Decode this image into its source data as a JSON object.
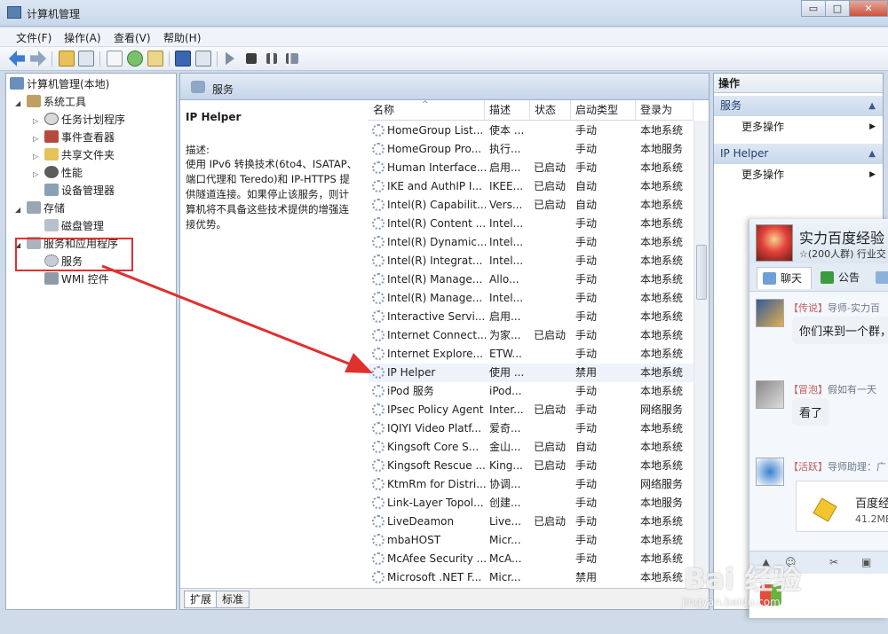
{
  "window": {
    "title": "计算机管理",
    "buttons": [
      "▭",
      "□",
      "✕"
    ]
  },
  "menu": [
    "文件(F)",
    "操作(A)",
    "查看(V)",
    "帮助(H)"
  ],
  "tree": {
    "root": "计算机管理(本地)",
    "system_tools": "系统工具",
    "task_scheduler": "任务计划程序",
    "event_viewer": "事件查看器",
    "shared_folders": "共享文件夹",
    "performance": "性能",
    "device_manager": "设备管理器",
    "storage": "存储",
    "disk_management": "磁盘管理",
    "services_apps": "服务和应用程序",
    "services": "服务",
    "wmi": "WMI 控件"
  },
  "main": {
    "header": "服务",
    "selected_service": "IP Helper",
    "desc_label": "描述:",
    "desc_lines": [
      "使用 IPv6 转换技术(6to4、ISATAP、",
      "端口代理和 Teredo)和 IP-HTTPS 提",
      "供隧道连接。如果停止该服务，则计",
      "算机将不具备这些技术提供的增强连",
      "接优势。"
    ],
    "columns": [
      "名称",
      "描述",
      "状态",
      "启动类型",
      "登录为"
    ],
    "rows": [
      [
        "HomeGroup List...",
        "使本 ...",
        "",
        "手动",
        "本地系统"
      ],
      [
        "HomeGroup Pro...",
        "执行...",
        "",
        "手动",
        "本地服务"
      ],
      [
        "Human Interface...",
        "启用...",
        "已启动",
        "手动",
        "本地系统"
      ],
      [
        "IKE and AuthIP I...",
        "IKEE...",
        "已启动",
        "自动",
        "本地系统"
      ],
      [
        "Intel(R) Capabilit...",
        "Vers...",
        "已启动",
        "自动",
        "本地系统"
      ],
      [
        "Intel(R) Content ...",
        "Intel...",
        "",
        "手动",
        "本地系统"
      ],
      [
        "Intel(R) Dynamic...",
        "Intel...",
        "",
        "手动",
        "本地系统"
      ],
      [
        "Intel(R) Integrat...",
        "Intel...",
        "",
        "手动",
        "本地系统"
      ],
      [
        "Intel(R) Manage...",
        "Allo...",
        "",
        "手动",
        "本地系统"
      ],
      [
        "Intel(R) Manage...",
        "Intel...",
        "",
        "手动",
        "本地系统"
      ],
      [
        "Interactive Servi...",
        "启用...",
        "",
        "手动",
        "本地系统"
      ],
      [
        "Internet Connect...",
        "为家...",
        "已启动",
        "手动",
        "本地系统"
      ],
      [
        "Internet Explore...",
        "ETW...",
        "",
        "手动",
        "本地系统"
      ],
      [
        "IP Helper",
        "使用 ...",
        "",
        "禁用",
        "本地系统"
      ],
      [
        "iPod 服务",
        "iPod...",
        "",
        "手动",
        "本地系统"
      ],
      [
        "IPsec Policy Agent",
        "Inter...",
        "已启动",
        "手动",
        "网络服务"
      ],
      [
        "IQIYI Video Platf...",
        "爱奇...",
        "",
        "手动",
        "本地系统"
      ],
      [
        "Kingsoft Core S...",
        "金山...",
        "已启动",
        "自动",
        "本地系统"
      ],
      [
        "Kingsoft Rescue ...",
        "King...",
        "已启动",
        "手动",
        "本地系统"
      ],
      [
        "KtmRm for Distri...",
        "协调...",
        "",
        "手动",
        "网络服务"
      ],
      [
        "Link-Layer Topol...",
        "创建...",
        "",
        "手动",
        "本地服务"
      ],
      [
        "LiveDeamon",
        "Live...",
        "已启动",
        "手动",
        "本地系统"
      ],
      [
        "mbaHOST",
        "Micr...",
        "",
        "手动",
        "本地系统"
      ],
      [
        "McAfee Security ...",
        "McA...",
        "",
        "手动",
        "本地系统"
      ],
      [
        "Microsoft .NET F...",
        "Micr...",
        "",
        "禁用",
        "本地系统"
      ]
    ],
    "tabs": [
      "扩展",
      "标准"
    ]
  },
  "actions": {
    "header": "操作",
    "group1": "服务",
    "group1_item": "更多操作",
    "group2": "IP Helper",
    "group2_item": "更多操作"
  },
  "chat": {
    "group_name": "实力百度经验",
    "group_sub": "☆(200人群) 行业交",
    "tab_chat": "聊天",
    "tab_notice": "公告",
    "msg1_tag": "【传说】",
    "msg1_name": "导师-实力百",
    "msg1_text": "你们来到一个群，",
    "msg2_tag": "【冒泡】",
    "msg2_name": "假如有一天",
    "msg2_text": "看了",
    "msg3_tag": "【活跃】",
    "msg3_name": "导师助理：广",
    "file_name": "百度经",
    "file_size": "41.2MB"
  },
  "watermark": {
    "logo": "Bai 经验",
    "url": "jingyan.baidu.com"
  }
}
